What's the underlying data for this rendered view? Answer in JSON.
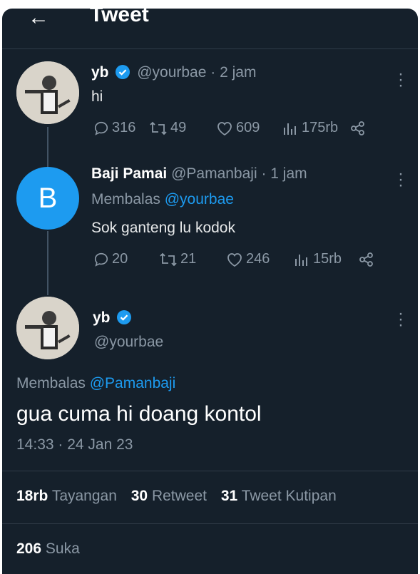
{
  "header": {
    "back_icon": "back-arrow-icon",
    "title": "Tweet"
  },
  "tweet1": {
    "name": "yb",
    "handle": "@yourbae",
    "time": "· 2 jam",
    "text": "hi",
    "replies": "316",
    "retweets": "49",
    "likes": "609",
    "views": "175rb"
  },
  "tweet2": {
    "avatar_letter": "B",
    "name": "Baji Pamai",
    "handle": "@Pamanbaji",
    "time": "· 1 jam",
    "replying_prefix": "Membalas",
    "replying_to": "@yourbae",
    "text": "Sok ganteng lu kodok",
    "replies": "20",
    "retweets": "21",
    "likes": "246",
    "views": "15rb"
  },
  "main": {
    "name": "yb",
    "handle": "@yourbae",
    "replying_prefix": "Membalas",
    "replying_to": "@Pamanbaji",
    "text": "gua cuma hi doang kontol",
    "timestamp": "14:33 · 24 Jan 23",
    "views_count": "18rb",
    "views_label": "Tayangan",
    "retweets_count": "30",
    "retweets_label": "Retweet",
    "quotes_count": "31",
    "quotes_label": "Tweet Kutipan",
    "likes_count": "206",
    "likes_label": "Suka"
  },
  "colors": {
    "background": "#15202b",
    "accent": "#1d9bf0",
    "muted": "#8b98a5",
    "text": "#e7e9ea"
  }
}
